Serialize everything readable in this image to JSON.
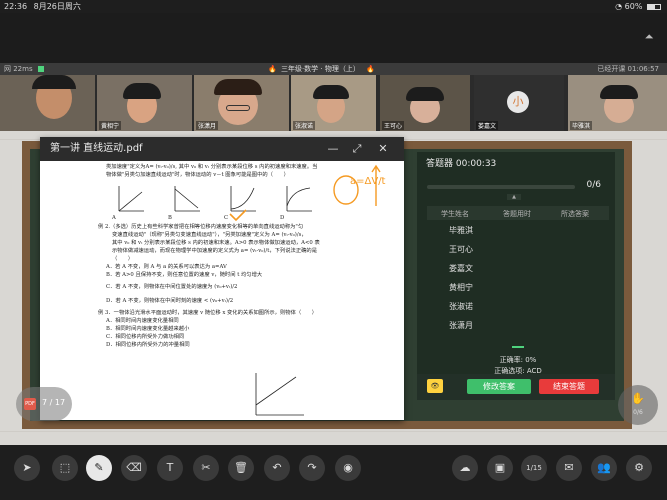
{
  "status_bar": {
    "time": "22:36",
    "date": "8月26日周六",
    "wifi_icon": "wifi-icon",
    "battery_text": "60%",
    "battery_level": 0.6
  },
  "class_bar": {
    "left_text": "网 22ms",
    "signal_text": "",
    "mid_text": "三年级·数学 · 物理（上）",
    "right_text": "已经开课 01:06:57"
  },
  "videos": [
    {
      "name": "",
      "skin": "#c48e6a"
    },
    {
      "name": "黄相宁",
      "skin": "#d9a382"
    },
    {
      "name": "张潇月",
      "skin": "#d8a88c"
    },
    {
      "name": "张淑诺",
      "skin": "#d4a486"
    },
    {
      "name": "王可心",
      "skin": "#d8b09a"
    },
    {
      "name": "娄嘉文",
      "avatar": "小"
    },
    {
      "name": "毕雅淇",
      "skin": "#d6ad94"
    }
  ],
  "pdf": {
    "title": "第一讲  直线运动.pdf",
    "minimize_icon": "minimize-icon",
    "maximize_icon": "maximize-icon",
    "close_icon": "close-icon",
    "lines": {
      "l1": "类加速度\"定义为A= (vₜ-v₀)/s, 其中 v₀ 和 vₜ 分别表示某段位移 s 内的初速度和末速度。当",
      "l2": "物体做\"另类匀加速直线运动\"时，物体运动的 v－t 图象可能是图中的（　　）",
      "g1": "A",
      "g2": "B",
      "g3": "C",
      "g4": "D",
      "l3": "例 2.（多选）历史上有些科学家曾把在相等位移内速度变化相等的单向直线运动称为\"匀",
      "l4": "变速直线运动\"（现称\"另类匀变速直线运动\"），\"另类加速度\"定义为 A= (vₜ-v₀)/s，",
      "l5": "其中 v₀ 和 vₜ 分别表示某段位移 s 内的初速和末速。A>0 表示物体做加速运动，A<0 表",
      "l6": "示物体做减速运动，而现在物理学中加速度的定义式为 a= (vₜ-v₀)/t，下列说法正确的是",
      "l7": "（　　）",
      "l8": "A．若 A 不变，则 A 与 a 的关系可以表达为 a=AV",
      "l9": "B．若 A>0 且保持不变，则任意位置的速度 v，随时间 t 均匀增大",
      "l10": "C．若 A 不变，则物体在中间位置处的速度为 (v₀+vₜ)/2",
      "l11": "D．若 A 不变，则物体在中间时刻的速度 < (v₀+vₜ)/2",
      "l12": "例 3．一物体沿光滑水平面运动时，其速度 v 随位移 x 变化的关系如图所示，则物体（　　）",
      "l13": "A．相同时间内速度变化量相同",
      "l14": "B．相同时间内速度变化量越来越小",
      "l15": "C．相同位移内所受外力做功相同",
      "l16": "D．相同位移内所受外力的冲量相同",
      "ann_formula": "a=ΔV/t"
    }
  },
  "page_indicator": {
    "text": "7 / 17",
    "badge": "PDF"
  },
  "answer_panel": {
    "title": "答题器 00:00:33",
    "progress_text": "0/6",
    "progress_value": 0,
    "columns": [
      "学生姓名",
      "答题用时",
      "所选答案"
    ],
    "students": [
      "毕雅淇",
      "王可心",
      "娄嘉文",
      "黄相宁",
      "张淑诺",
      "张潇月"
    ],
    "accuracy": "正确率: 0%",
    "correct_option": "正确选项: ACD",
    "modify_label": "修改答案",
    "end_label": "结束答题",
    "eye_icon": "eye-icon"
  },
  "side_float": {
    "label": "0/6",
    "icon": "hand-raise-icon"
  },
  "toolbar": {
    "left_tools": [
      {
        "name": "pointer-tool",
        "glyph": "➤"
      },
      {
        "name": "select-tool",
        "glyph": "⬚"
      },
      {
        "name": "pen-tool",
        "glyph": "✎"
      },
      {
        "name": "eraser-tool",
        "glyph": "⌫"
      },
      {
        "name": "text-tool",
        "glyph": "T"
      },
      {
        "name": "scissors-tool",
        "glyph": "✂"
      },
      {
        "name": "delete-tool",
        "glyph": "🗑"
      },
      {
        "name": "undo-tool",
        "glyph": "↶"
      },
      {
        "name": "redo-tool",
        "glyph": "↷"
      },
      {
        "name": "record-tool",
        "glyph": "◉"
      }
    ],
    "right_tools": [
      {
        "name": "cloud-tool",
        "glyph": "☁"
      },
      {
        "name": "toolbox-tool",
        "glyph": "▣"
      },
      {
        "name": "timer-tool",
        "glyph": "1/15"
      },
      {
        "name": "chat-tool",
        "glyph": "✉"
      },
      {
        "name": "members-tool",
        "glyph": "👥"
      },
      {
        "name": "settings-tool",
        "glyph": "⚙"
      }
    ]
  }
}
